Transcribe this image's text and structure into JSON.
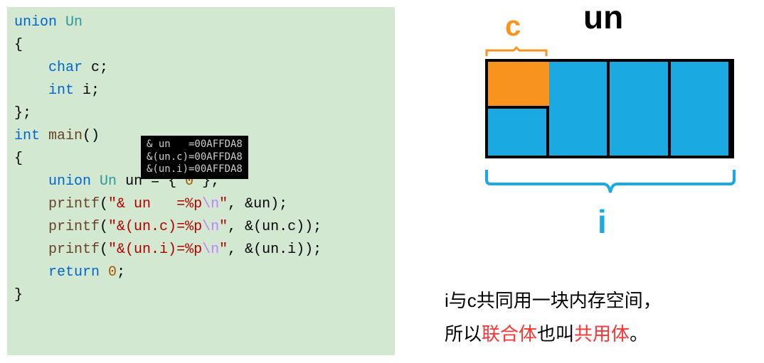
{
  "code": {
    "union_kw": "union",
    "un_type": "Un",
    "lbrace": "{",
    "char_kw": "char",
    "c_field": "c;",
    "int_kw": "int",
    "i_field": "i;",
    "rbrace_semi": "};",
    "int_kw2": "int",
    "main_id": "main",
    "main_parens": "()",
    "lbrace2": "{",
    "union_kw2": "union",
    "un_type2": "Un",
    "un_decl": "un = { ",
    "zero": "0",
    "un_decl_end": " };",
    "printf1_fn": "printf",
    "printf1_open": "(",
    "printf1_str_a": "\"& un   =%p",
    "printf1_esc": "\\n",
    "printf1_str_b": "\"",
    "printf1_args": ", &un);",
    "printf2_fn": "printf",
    "printf2_open": "(",
    "printf2_str_a": "\"&(un.c)=%p",
    "printf2_esc": "\\n",
    "printf2_str_b": "\"",
    "printf2_args": ", &(un.c));",
    "printf3_fn": "printf",
    "printf3_open": "(",
    "printf3_str_a": "\"&(un.i)=%p",
    "printf3_esc": "\\n",
    "printf3_str_b": "\"",
    "printf3_args": ", &(un.i));",
    "return_kw": "return",
    "return_val": "0",
    "return_semi": ";",
    "rbrace2": "}"
  },
  "tooltip": {
    "line1": "& un   =00AFFDA8",
    "line2": "&(un.c)=00AFFDA8",
    "line3": "&(un.i)=00AFFDA8"
  },
  "diagram": {
    "un_label": "un",
    "c_label": "c",
    "i_label": "i"
  },
  "caption": {
    "t1": "i与c共同用一块内存空间，",
    "t2a": "所以",
    "t2b": "联合体",
    "t2c": "也叫",
    "t2d": "共用体",
    "t2e": "。"
  }
}
